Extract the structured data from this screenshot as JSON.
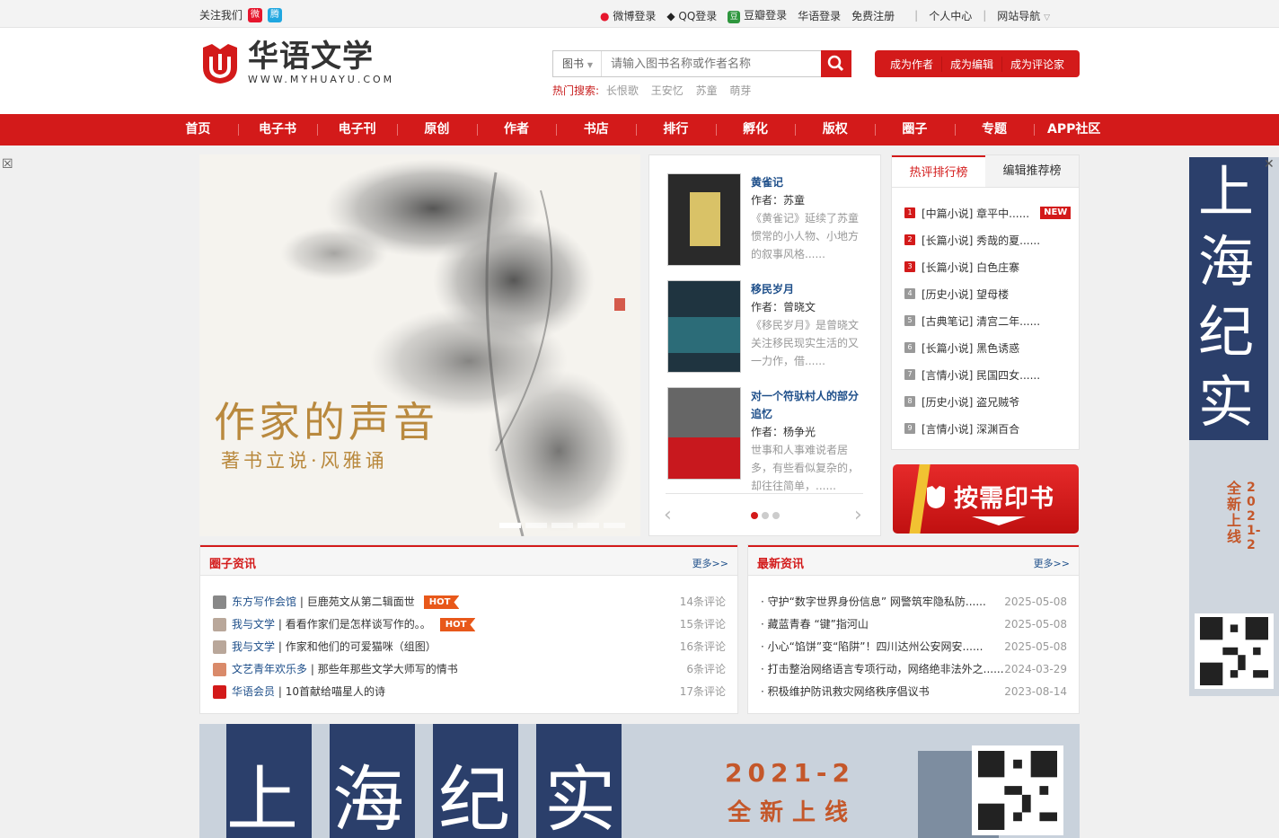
{
  "topbar": {
    "follow_label": "关注我们",
    "links": [
      "微博登录",
      "QQ登录",
      "豆瓣登录",
      "华语登录",
      "免费注册",
      "个人中心",
      "网站导航"
    ]
  },
  "logo": {
    "cn": "华语文学",
    "en": "WWW.MYHUAYU.COM"
  },
  "search": {
    "category": "图书",
    "placeholder": "请输入图书名称或作者名称",
    "hot_label": "热门搜索:",
    "hot_keywords": [
      "长恨歌",
      "王安忆",
      "苏童",
      "萌芽"
    ]
  },
  "roles": [
    "成为作者",
    "成为编辑",
    "成为评论家"
  ],
  "nav": [
    "首页",
    "电子书",
    "电子刊",
    "原创",
    "作者",
    "书店",
    "排行",
    "孵化",
    "版权",
    "圈子",
    "专题",
    "APP社区"
  ],
  "banner": {
    "title": "作家的声音",
    "subtitle": "著书立说·风雅诵"
  },
  "books": [
    {
      "title": "黄雀记",
      "author": "作者：苏童",
      "desc": "《黄雀记》延续了苏童惯常的小人物、小地方的叙事风格......",
      "cover_color": "#2a2a2a"
    },
    {
      "title": "移民岁月",
      "author": "作者：曾晓文",
      "desc": "《移民岁月》是曾晓文关注移民现实生活的又一力作，借......",
      "cover_color": "#1f3440"
    },
    {
      "title": "对一个符驮村人的部分追忆",
      "author": "作者：杨争光",
      "desc": "世事和人事难说者居多，有些看似复杂的，却往往简单，......",
      "cover_color": "#c8181e"
    }
  ],
  "rank": {
    "tabs": [
      "热评排行榜",
      "编辑推荐榜"
    ],
    "new_badge": "NEW",
    "items": [
      {
        "no": "1",
        "text": "[中篇小说] 章平中......"
      },
      {
        "no": "2",
        "text": "[长篇小说] 秀哉的夏......"
      },
      {
        "no": "3",
        "text": "[长篇小说] 白色庄寨"
      },
      {
        "no": "4",
        "text": "[历史小说] 望母楼"
      },
      {
        "no": "5",
        "text": "[古典笔记] 清宫二年......"
      },
      {
        "no": "6",
        "text": "[长篇小说] 黑色诱惑"
      },
      {
        "no": "7",
        "text": "[言情小说] 民国四女......"
      },
      {
        "no": "8",
        "text": "[历史小说] 盗兄贼爷"
      },
      {
        "no": "9",
        "text": "[言情小说] 深渊百合"
      }
    ]
  },
  "print_label": "按需印书",
  "circle_news": {
    "title": "圈子资讯",
    "more": "更多>>",
    "hot_badge": "HOT",
    "items": [
      {
        "source": "东方写作会馆",
        "text": " | 巨鹿苑文从第二辑面世",
        "comments": "14条评论",
        "hot": true,
        "ava": "#888"
      },
      {
        "source": "我与文学",
        "text": " | 看看作家们是怎样谈写作的。。",
        "comments": "15条评论",
        "hot": true,
        "ava": "#b9a79a"
      },
      {
        "source": "我与文学",
        "text": " | 作家和他们的可爱猫咪（组图）",
        "comments": "16条评论",
        "hot": false,
        "ava": "#b9a79a"
      },
      {
        "source": "文艺青年欢乐多",
        "text": " | 那些年那些文学大师写的情书",
        "comments": "6条评论",
        "hot": false,
        "ava": "#d98a6a"
      },
      {
        "source": "华语会员",
        "text": " | 10首献给喵星人的诗",
        "comments": "17条评论",
        "hot": false,
        "ava": "#d31a1a"
      }
    ]
  },
  "latest_news": {
    "title": "最新资讯",
    "more": "更多>>",
    "items": [
      {
        "text": "守护“数字世界身份信息” 网警筑牢隐私防......",
        "date": "2025-05-08"
      },
      {
        "text": "藏蓝青春 “键”指河山",
        "date": "2025-05-08"
      },
      {
        "text": "小心“馅饼”变“陷阱”！四川达州公安网安......",
        "date": "2025-05-08"
      },
      {
        "text": "打击整治网络语言专项行动，网络绝非法外之......",
        "date": "2024-03-29"
      },
      {
        "text": "积极维护防讯救灾网络秩序倡议书",
        "date": "2023-08-14"
      }
    ]
  },
  "ad": {
    "big_text": "上海纪实",
    "year": "2021-2",
    "slogan": "全新上线"
  }
}
